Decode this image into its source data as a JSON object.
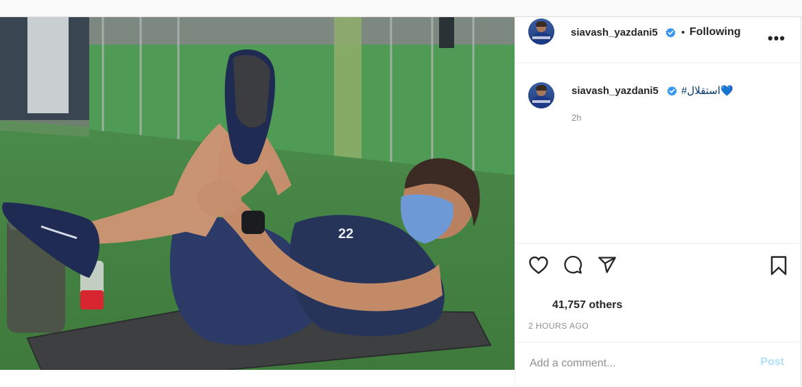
{
  "post": {
    "username": "siavash_yazdani5",
    "separator": "•",
    "follow_state": "Following",
    "more_label": "•••"
  },
  "caption": {
    "username": "siavash_yazdani5",
    "hashtag": "#استقلال",
    "emoji": "💙",
    "time": "2h"
  },
  "engagement": {
    "likes": "41,757 others",
    "posted": "2 HOURS AGO"
  },
  "comment": {
    "placeholder": "Add a comment...",
    "post_label": "Post"
  },
  "colors": {
    "verified_badge": "#3897f0",
    "hashtag": "#00376b",
    "post_button_disabled": "#b2dffc",
    "team_jersey": "#2b3a66"
  },
  "icons": [
    "verified-icon",
    "heart-icon",
    "comment-icon",
    "share-icon",
    "bookmark-icon",
    "more-options-icon"
  ]
}
